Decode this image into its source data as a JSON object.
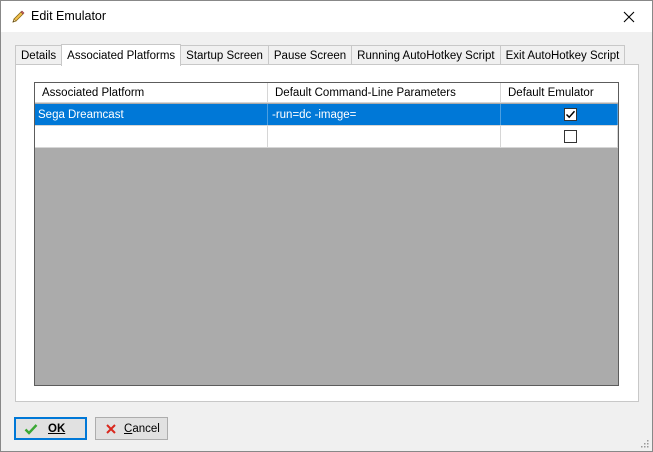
{
  "window": {
    "title": "Edit Emulator",
    "icon": "pencil-icon"
  },
  "tabs": [
    {
      "label": "Details",
      "active": false
    },
    {
      "label": "Associated Platforms",
      "active": true
    },
    {
      "label": "Startup Screen",
      "active": false
    },
    {
      "label": "Pause Screen",
      "active": false
    },
    {
      "label": "Running AutoHotkey Script",
      "active": false
    },
    {
      "label": "Exit AutoHotkey Script",
      "active": false
    }
  ],
  "grid": {
    "columns": [
      "Associated Platform",
      "Default Command-Line Parameters",
      "Default Emulator"
    ],
    "rows": [
      {
        "platform": "Sega Dreamcast",
        "params": "-run=dc -image=",
        "default": true,
        "selected": true
      },
      {
        "platform": "",
        "params": "",
        "default": false,
        "selected": false
      }
    ]
  },
  "buttons": {
    "ok": "OK",
    "cancel": "Cancel"
  },
  "colors": {
    "selection": "#0078d7",
    "grid_background": "#ababab",
    "ok_icon": "#3aa834",
    "cancel_icon": "#d9281e"
  }
}
